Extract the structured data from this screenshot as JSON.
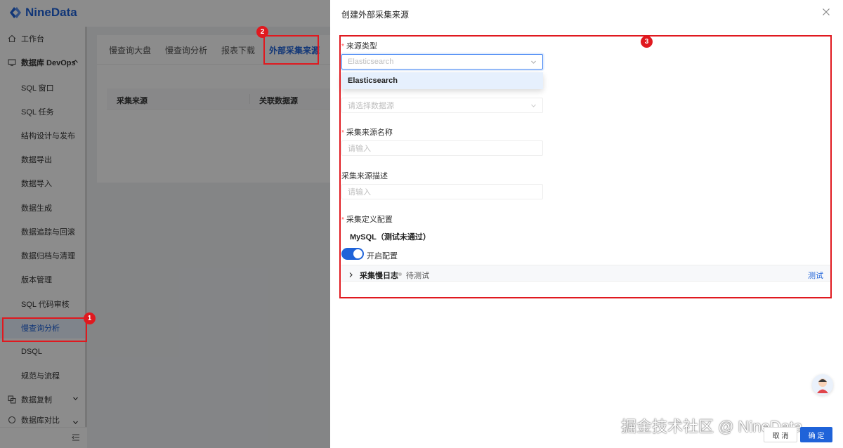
{
  "app": {
    "logo_text": "NineData"
  },
  "sidebar": {
    "items": [
      {
        "label": "工作台"
      },
      {
        "label": "数据库 DevOps"
      },
      {
        "label": "SQL 窗口"
      },
      {
        "label": "SQL 任务"
      },
      {
        "label": "结构设计与发布"
      },
      {
        "label": "数据导出"
      },
      {
        "label": "数据导入"
      },
      {
        "label": "数据生成"
      },
      {
        "label": "数据追踪与回滚"
      },
      {
        "label": "数据归档与清理"
      },
      {
        "label": "版本管理"
      },
      {
        "label": "SQL 代码审核"
      },
      {
        "label": "慢查询分析"
      },
      {
        "label": "DSQL"
      },
      {
        "label": "规范与流程"
      },
      {
        "label": "数据复制"
      },
      {
        "label": "数据库对比"
      }
    ]
  },
  "main": {
    "tabs": [
      {
        "label": "慢查询大盘"
      },
      {
        "label": "慢查询分析"
      },
      {
        "label": "报表下载"
      },
      {
        "label": "外部采集来源"
      }
    ],
    "table_headers": [
      "采集来源",
      "关联数据源"
    ]
  },
  "drawer": {
    "title": "创建外部采集来源",
    "source_type": {
      "label": "来源类型",
      "value": "Elasticsearch",
      "options": [
        "Elasticsearch"
      ]
    },
    "datasource": {
      "placeholder": "请选择数据源"
    },
    "name": {
      "label": "采集来源名称",
      "placeholder": "请输入"
    },
    "description": {
      "label": "采集来源描述",
      "placeholder": "请输入"
    },
    "config": {
      "label": "采集定义配置",
      "title": "MySQL（测试未通过）",
      "toggle_label": "开启配置",
      "toggle_on": true,
      "item_name": "采集慢日志",
      "item_status": "待测试",
      "test_label": "测试"
    },
    "footer": {
      "cancel": "取 消",
      "ok": "确 定"
    }
  },
  "annotations": [
    "1",
    "2",
    "3"
  ],
  "watermark": "掘金技术社区 @ NineData",
  "colors": {
    "brand": "#1f63d9",
    "annotation": "#e0191f",
    "required": "#ff4d4f"
  }
}
